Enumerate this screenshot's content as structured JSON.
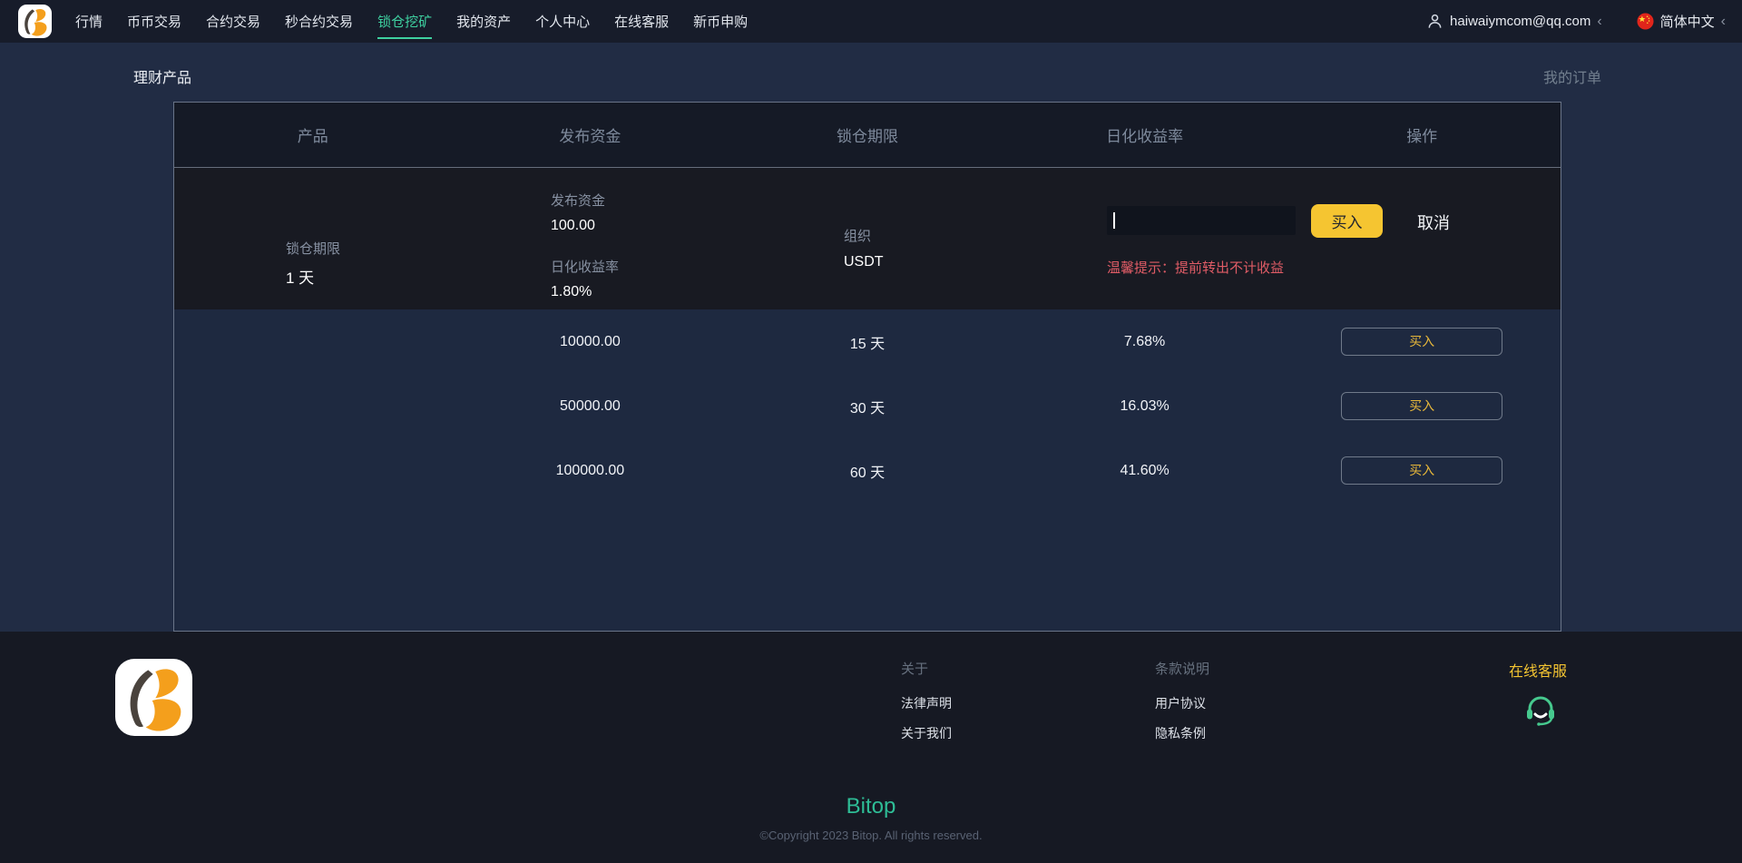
{
  "colors": {
    "accent_yellow": "#f5c531",
    "active_green": "#3ed0a0",
    "brand_teal": "#2ebd96",
    "warning_red": "#e05c66",
    "service_green": "#46c98e"
  },
  "navbar": {
    "items": [
      {
        "label": "行情",
        "active": false
      },
      {
        "label": "币币交易",
        "active": false
      },
      {
        "label": "合约交易",
        "active": false
      },
      {
        "label": "秒合约交易",
        "active": false
      },
      {
        "label": "锁仓挖矿",
        "active": true
      },
      {
        "label": "我的资产",
        "active": false
      },
      {
        "label": "个人中心",
        "active": false
      },
      {
        "label": "在线客服",
        "active": false
      },
      {
        "label": "新币申购",
        "active": false
      }
    ],
    "account": {
      "email": "haiwaiymcom@qq.com",
      "chevron": "‹"
    },
    "language": {
      "label": "简体中文",
      "chevron": "‹"
    }
  },
  "page": {
    "title": "理财产品",
    "orders_link": "我的订单"
  },
  "table": {
    "headers": [
      "产品",
      "发布资金",
      "锁仓期限",
      "日化收益率",
      "操作"
    ],
    "expanded": {
      "lock_label": "锁仓期限",
      "lock_value": "1 天",
      "fund_label": "发布资金",
      "fund_value": "100.00",
      "rate_label": "日化收益率",
      "rate_value": "1.80%",
      "org_label": "组织",
      "org_value": "USDT",
      "input_value": "",
      "buy_label": "买入",
      "cancel_label": "取消",
      "warning": "温馨提示：提前转出不计收益"
    },
    "rows": [
      {
        "fund": "10000.00",
        "period": "15 天",
        "rate": "7.68%",
        "action": "买入"
      },
      {
        "fund": "50000.00",
        "period": "30 天",
        "rate": "16.03%",
        "action": "买入"
      },
      {
        "fund": "100000.00",
        "period": "60 天",
        "rate": "41.60%",
        "action": "买入"
      }
    ]
  },
  "footer": {
    "about": {
      "heading": "关于",
      "links": [
        "法律声明",
        "关于我们"
      ]
    },
    "terms": {
      "heading": "条款说明",
      "links": [
        "用户协议",
        "隐私条例"
      ]
    },
    "service": {
      "heading": "在线客服"
    },
    "brand": "Bitop",
    "copyright": "©Copyright 2023 Bitop. All rights reserved."
  }
}
